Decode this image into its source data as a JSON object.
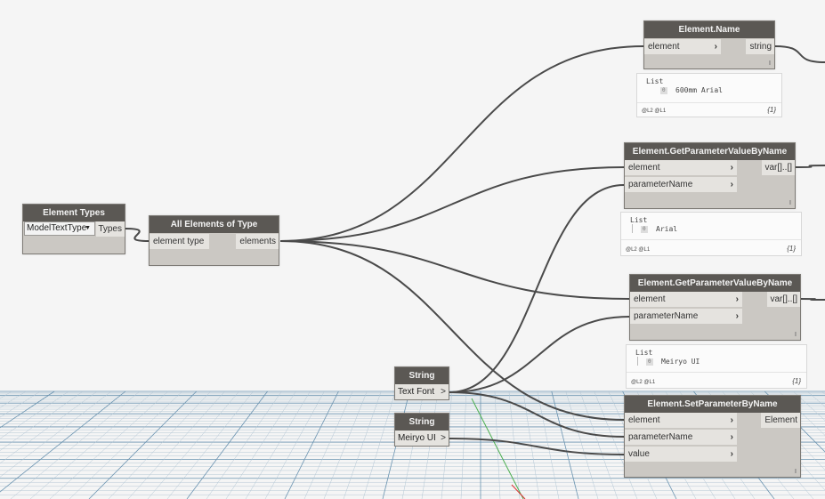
{
  "nodes": {
    "element_types": {
      "title": "Element Types",
      "dropdown_value": "ModelTextType",
      "output": "Types"
    },
    "all_elements": {
      "title": "All Elements of Type",
      "input": "element type",
      "output": "elements"
    },
    "element_name": {
      "title": "Element.Name",
      "input": "element",
      "output": "string",
      "footer": "I",
      "preview": {
        "title": "List",
        "index": "0",
        "value": "600mm Arial",
        "levels": "@L2 @L1",
        "count": "{1}"
      }
    },
    "get_param_1": {
      "title": "Element.GetParameterValueByName",
      "inputs": [
        "element",
        "parameterName"
      ],
      "output": "var[]..[]",
      "footer": "I",
      "preview": {
        "title": "List",
        "index": "0",
        "value": "Arial",
        "levels": "@L2 @L1",
        "count": "{1}"
      }
    },
    "get_param_2": {
      "title": "Element.GetParameterValueByName",
      "inputs": [
        "element",
        "parameterName"
      ],
      "output": "var[]..[]",
      "footer": "I",
      "preview": {
        "title": "List",
        "index": "0",
        "value": "Meiryo UI",
        "levels": "@L2 @L1",
        "count": "{1}"
      }
    },
    "string_1": {
      "title": "String",
      "value": "Text Font",
      "chevron": ">"
    },
    "string_2": {
      "title": "String",
      "value": "Meiryo UI",
      "chevron": ">"
    },
    "set_param": {
      "title": "Element.SetParameterByName",
      "inputs": [
        "element",
        "parameterName",
        "value"
      ],
      "output": "Element",
      "footer": "I"
    }
  },
  "colors": {
    "background": "#f5f5f5",
    "node_header": "#5b5854",
    "node_body": "#cbc8c3",
    "port": "#e5e3df",
    "wire": "#4a4a4a",
    "grid_major": "#6a93b0",
    "grid_minor": "#b3c6d4",
    "grid_axis_green": "#4caf50",
    "grid_axis_red": "#d33"
  }
}
